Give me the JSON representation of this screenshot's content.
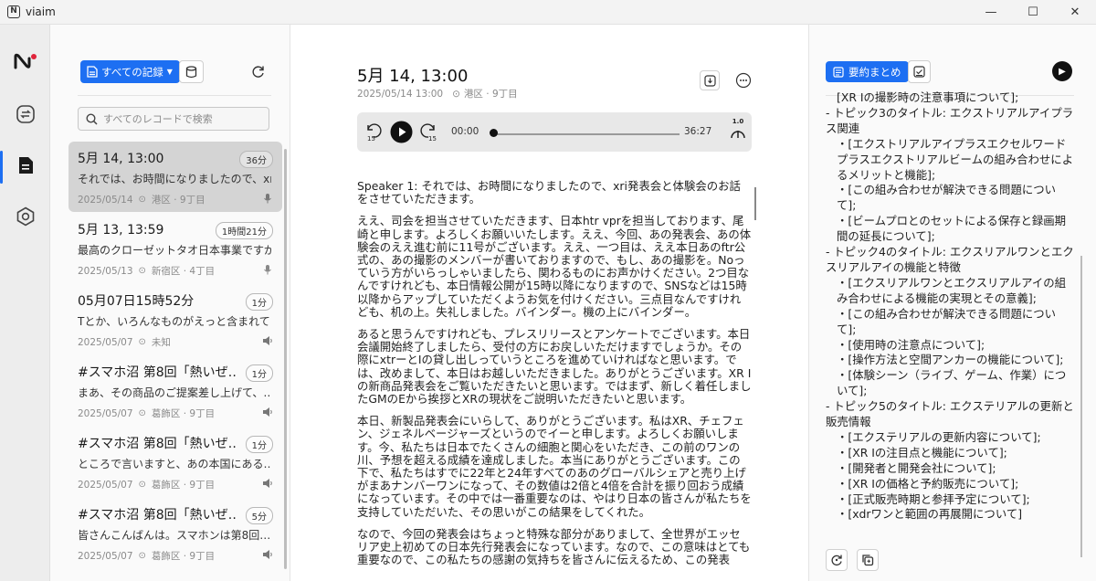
{
  "window": {
    "app_name": "viaim",
    "minimize": "—",
    "maximize": "☐",
    "close": "✕"
  },
  "list": {
    "filter_label": "すべての記録",
    "search": {
      "placeholder": "すべてのレコードで検索",
      "value": ""
    },
    "records": [
      {
        "title": "5月 14, 13:00",
        "duration": "36分",
        "snippet": "それでは、お時間になりましたので、xri発表会と体験会のお話",
        "date": "2025/05/14",
        "location": "港区 · 9丁目",
        "type_icon": "mic-icon",
        "active": true
      },
      {
        "title": "5月 13, 13:59",
        "duration": "1時間21分",
        "snippet": "最高のクローゼットタオ日本事業ですが…",
        "date": "2025/05/13",
        "location": "新宿区 · 4丁目",
        "type_icon": "mic-icon",
        "active": false
      },
      {
        "title": "05月07日15時52分",
        "duration": "1分",
        "snippet": "Tとか、いろんなものがえっと含まれて…",
        "date": "2025/05/07",
        "location": "未知",
        "type_icon": "speaker-icon",
        "active": false
      },
      {
        "title": "#スマホ沼 第8回「熱いぜ…",
        "duration": "1分",
        "snippet": "まあ、その商品のご提案差し上げて、…",
        "date": "2025/05/07",
        "location": "葛飾区 · 9丁目",
        "type_icon": "speaker-icon",
        "active": false
      },
      {
        "title": "#スマホ沼 第8回「熱いぜ…",
        "duration": "1分",
        "snippet": "ところで言いますと、あの本国にある…",
        "date": "2025/05/07",
        "location": "葛飾区 · 9丁目",
        "type_icon": "speaker-icon",
        "active": false
      },
      {
        "title": "#スマホ沼 第8回「熱いぜ…",
        "duration": "5分",
        "snippet": "皆さんこんばんは。スマホンは第8回…",
        "date": "2025/05/07",
        "location": "葛飾区 · 9丁目",
        "type_icon": "speaker-icon",
        "active": false
      }
    ]
  },
  "main": {
    "title": "5月 14, 13:00",
    "datetime": "2025/05/14 13:00",
    "location": "港区 · 9丁目",
    "player": {
      "rewind_label": "15",
      "forward_label": "15",
      "current_time": "00:00",
      "total_time": "36:27",
      "speed": "1.0",
      "progress": 0.0
    },
    "transcript": [
      "Speaker 1: それでは、お時間になりましたので、xri発表会と体験会のお話をさせていただきます。",
      "ええ、司会を担当させていただきます、日本htr vprを担当しております、尾崎と申します。よろしくお願いいたします。ええ、今回、あの発表会、あの体験会のええ進む前に11号がございます。ええ、一つ目は、ええ本日あのftr公式の、あの撮影のメンバーが書いておりますので、もし、あの撮影を。Noっていう方がいらっしゃいましたら、関わるものにお声かけください。2つ目なんですけれども、本日情報公開が15時以降になりますので、SNSなどは15時以降からアップしていただくようお気を付けください。三点目なんですけれども、机の上。失礼しました。バインダー。機の上にバインダー。",
      "あると思うんですけれども、プレスリリースとアンケートでございます。本日会議開始終了しましたら、受付の方にお戻しいただけますでしょうか。その際にxtrーとIの貸し出しっていうところを進めていければなと思います。では、改めまして、本日はお越しいただきました。ありがとうございます。XR Iの新商品発表会をご覧いただきたいと思います。ではまず、新しく着任しましたGMのEから挨拶とXRの現状をご説明いただきたいと思います。",
      "本日、新製品発表会にいらして、ありがとうございます。私はXR、チェフェン、ジェネルベージャーズというのでイーと申します。よろしくお願いします。今、私たちは日本でたくさんの細胞と関心をいただき、この前のワンの川、予想を超える成績を達成しました。本当にありがとうございます。この下で、私たちはすでに22年と24年すべてのあのグローバルシェアと売り上げがまあナンバーワンになって、その数値は2倍と4倍を合計を振り回おう成績になっています。その中では一番重要なのは、やはり日本の皆さんが私たちを支持していただいた、その思いがこの結果をしてくれた。",
      "なので、今回の発表会はちょっと特殊な部分がありまして、全世界がエッセリア史上初めての日本先行発表会になっています。なので、この意味はとても重要なので、この私たちの感謝の気持ちを皆さんに伝えるため、この発表"
    ]
  },
  "side": {
    "tab_summary": "要約まとめ",
    "summary_lines": [
      {
        "text": "[XR Iの撮影時の注意事項について];",
        "sub": true
      },
      {
        "text": "- トピック3のタイトル: エクストリアルアイプラス関連",
        "sub": false
      },
      {
        "text": "・[エクストリアルアイプラスエクセルワードプラスエクストリアルビームの組み合わせによるメリットと機能];",
        "sub": true
      },
      {
        "text": "・[この組み合わせが解決できる問題について];",
        "sub": true
      },
      {
        "text": "・[ビームプロとのセットによる保存と録画期間の延長について];",
        "sub": true
      },
      {
        "text": "- トピック4のタイトル: エクスリアルワンとエクスリアルアイの機能と特徴",
        "sub": false
      },
      {
        "text": "・[エクスリアルワンとエクスリアルアイの組み合わせによる機能の実現とその意義];",
        "sub": true
      },
      {
        "text": "・[この組み合わせが解決できる問題について];",
        "sub": true
      },
      {
        "text": "・[使用時の注意点について];",
        "sub": true
      },
      {
        "text": "・[操作方法と空間アンカーの機能について];",
        "sub": true
      },
      {
        "text": "・[体験シーン（ライブ、ゲーム、作業）について];",
        "sub": true
      },
      {
        "text": "- トピック5のタイトル: エクステリアルの更新と販売情報",
        "sub": false
      },
      {
        "text": "・[エクステリアルの更新内容について];",
        "sub": true
      },
      {
        "text": "・[XR Iの注目点と機能について];",
        "sub": true
      },
      {
        "text": "・[開発者と開発会社について];",
        "sub": true
      },
      {
        "text": "・[XR Iの価格と予約販売について];",
        "sub": true
      },
      {
        "text": "・[正式販売時期と参拝予定について];",
        "sub": true
      },
      {
        "text": "・[xdrワンと範囲の再展開について]",
        "sub": true
      }
    ]
  },
  "colors": {
    "accent": "#1d6ff2",
    "active_record_bg": "#d4d4d4",
    "rail_bg": "#ededed"
  }
}
